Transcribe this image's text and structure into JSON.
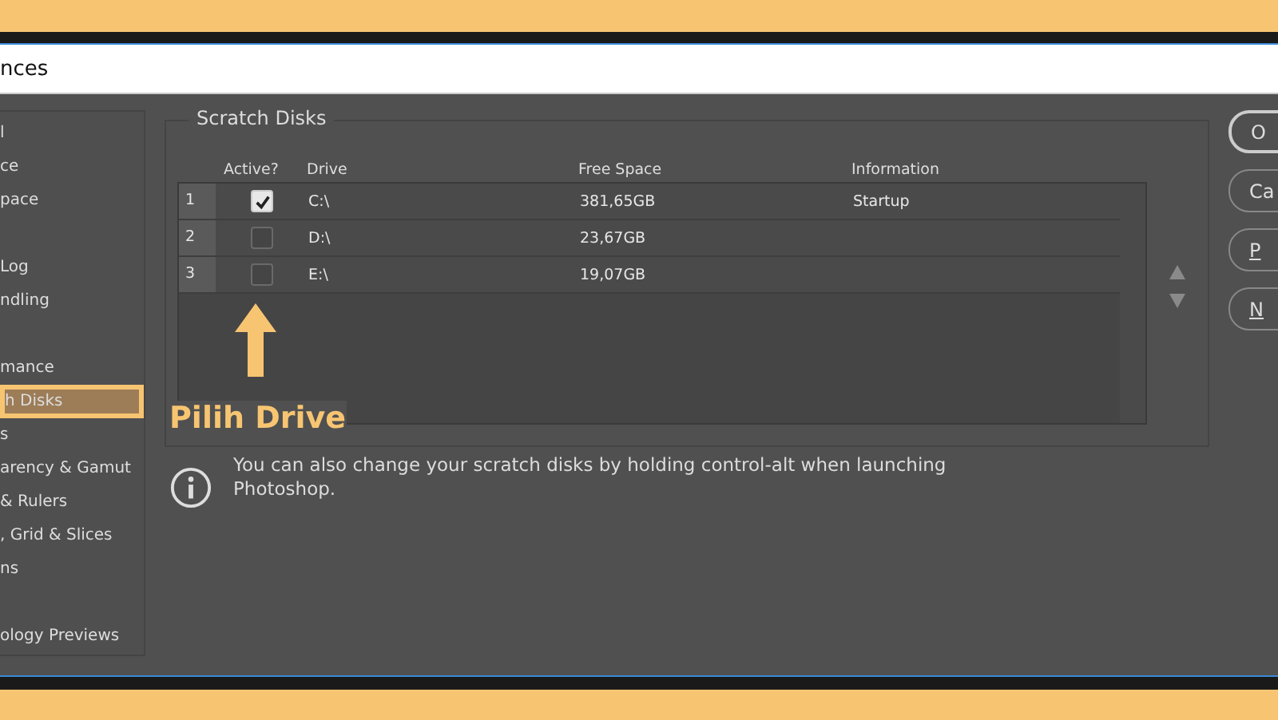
{
  "window": {
    "title": "nces"
  },
  "sidebar": {
    "items": [
      {
        "kind": "item",
        "label": "l",
        "selected": false
      },
      {
        "kind": "item",
        "label": "ce",
        "selected": false
      },
      {
        "kind": "item",
        "label": "pace",
        "selected": false
      },
      {
        "kind": "blank"
      },
      {
        "kind": "item",
        "label": "Log",
        "selected": false
      },
      {
        "kind": "item",
        "label": "ndling",
        "selected": false
      },
      {
        "kind": "blank"
      },
      {
        "kind": "item",
        "label": "mance",
        "selected": false
      },
      {
        "kind": "item",
        "label": "h Disks",
        "selected": true
      },
      {
        "kind": "item",
        "label": "s",
        "selected": false
      },
      {
        "kind": "item",
        "label": "arency & Gamut",
        "selected": false
      },
      {
        "kind": "item",
        "label": "& Rulers",
        "selected": false
      },
      {
        "kind": "item",
        "label": ", Grid & Slices",
        "selected": false
      },
      {
        "kind": "item",
        "label": "ns",
        "selected": false
      },
      {
        "kind": "blank"
      },
      {
        "kind": "item",
        "label": "ology Previews",
        "selected": false
      }
    ]
  },
  "scratch_disks": {
    "title": "Scratch Disks",
    "columns": [
      "Active?",
      "Drive",
      "Free Space",
      "Information"
    ],
    "rows": [
      {
        "index": "1",
        "active": true,
        "drive": "C:\\",
        "free_space": "381,65GB",
        "information": "Startup"
      },
      {
        "index": "2",
        "active": false,
        "drive": "D:\\",
        "free_space": "23,67GB"
      },
      {
        "index": "3",
        "active": false,
        "drive": "E:\\",
        "free_space": "19,07GB"
      }
    ]
  },
  "annotation": {
    "label": "Pilih Drive"
  },
  "info": {
    "text": "You can also change your scratch disks by holding control-alt when launching Photoshop."
  },
  "buttons": [
    {
      "label": "O",
      "default": true
    },
    {
      "label": "Ca",
      "default": false
    },
    {
      "label": "P",
      "default": false
    },
    {
      "label": "N",
      "default": false
    }
  ]
}
